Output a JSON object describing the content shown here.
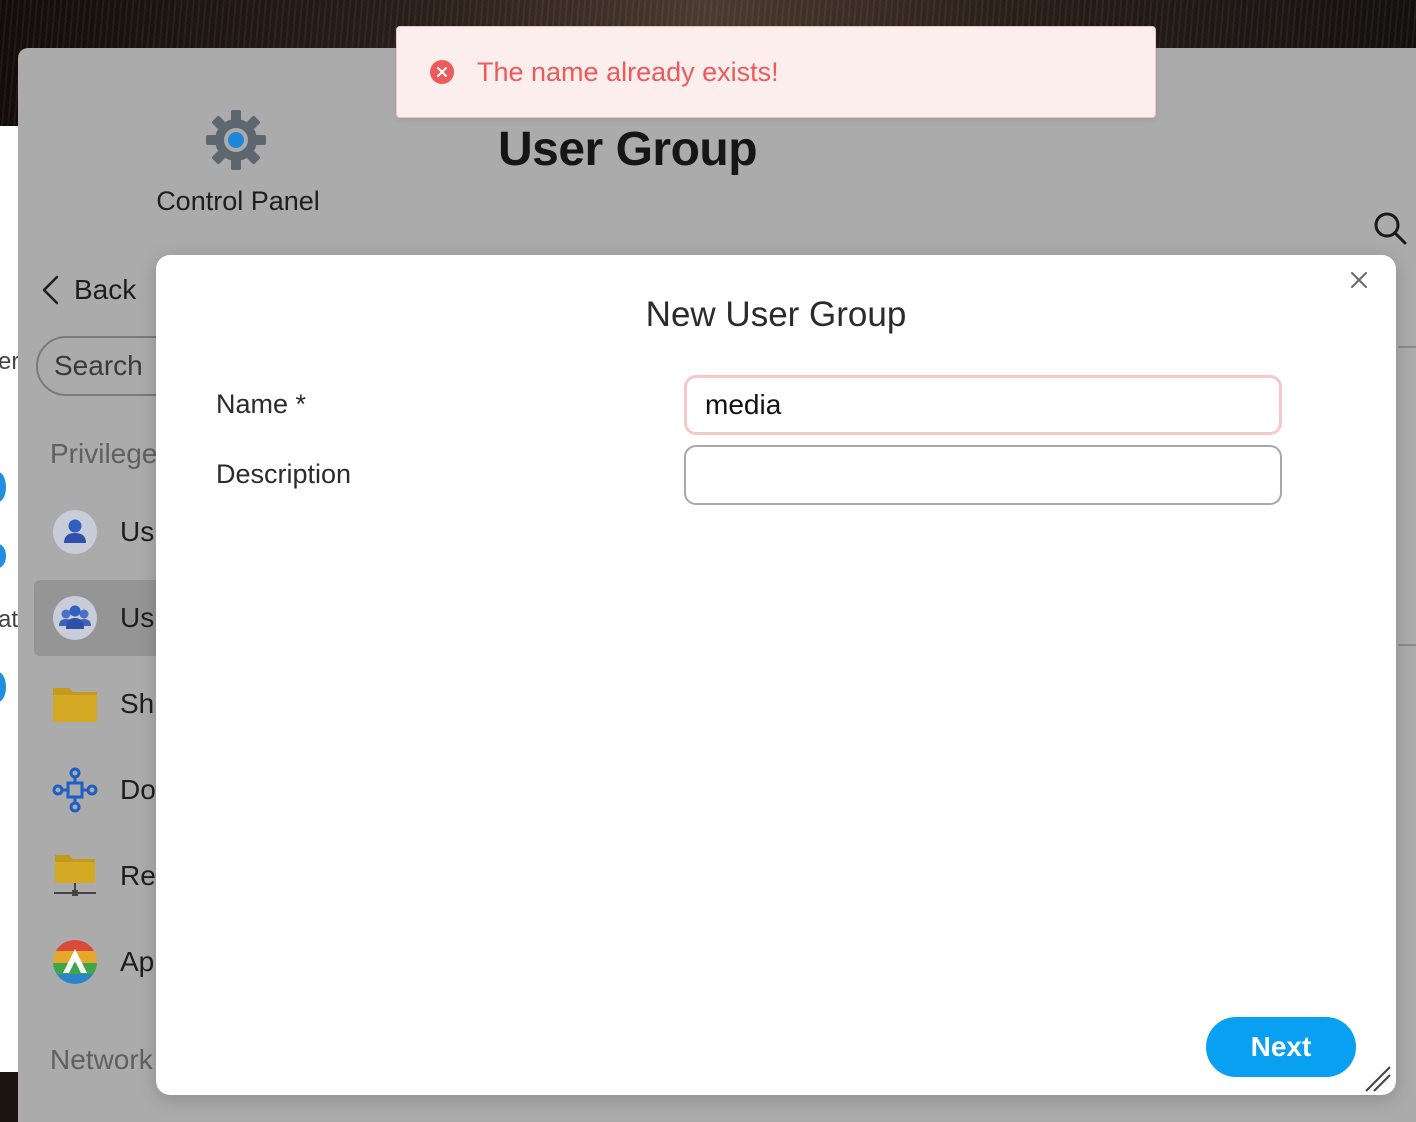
{
  "toast": {
    "message": "The name already exists!",
    "color": "#ec5a5a",
    "icon": "error-circle-icon"
  },
  "control_panel": {
    "app_name": "Control Panel",
    "page_title": "User Group",
    "back_label": "Back",
    "search_placeholder": "Search",
    "sections": [
      "Privilege",
      "Network"
    ],
    "items": [
      {
        "label": "Us",
        "icon": "user-icon"
      },
      {
        "label": "Us",
        "icon": "user-group-icon",
        "selected": true
      },
      {
        "label": "Sh",
        "icon": "shared-folder-icon"
      },
      {
        "label": "Do",
        "icon": "domain-network-icon"
      },
      {
        "label": "Re",
        "icon": "remote-folder-icon"
      },
      {
        "label": "Ap",
        "icon": "app-privilege-icon"
      }
    ]
  },
  "behind_app": {
    "fragments": [
      "er",
      "at"
    ]
  },
  "modal": {
    "title": "New User Group",
    "name_label": "Name *",
    "name_value": "media",
    "description_label": "Description",
    "description_value": "",
    "next_label": "Next",
    "accent": "#0aa0f2"
  }
}
